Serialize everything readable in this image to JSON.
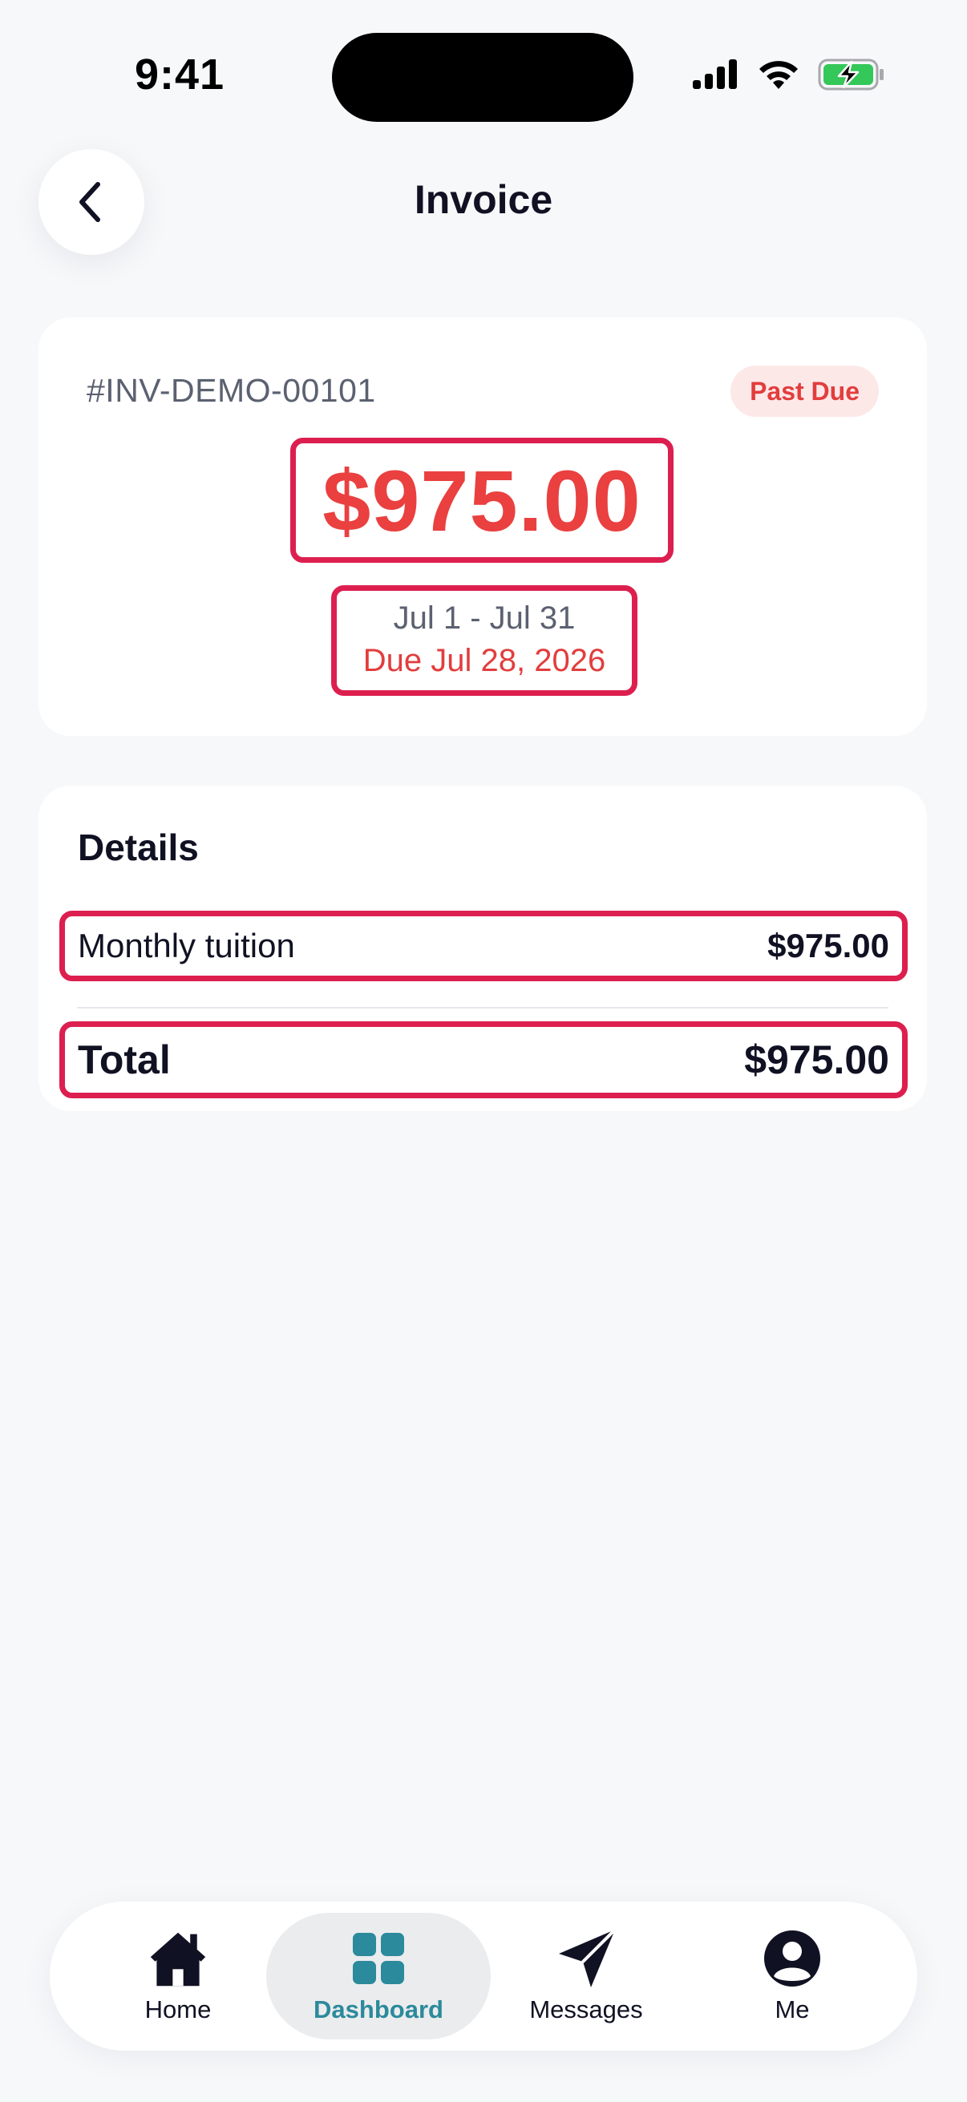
{
  "status_bar": {
    "time": "9:41",
    "icons": [
      "cellular-signal-icon",
      "wifi-icon",
      "battery-charging-icon"
    ]
  },
  "header": {
    "title": "Invoice",
    "back_icon": "chevron-left-icon"
  },
  "invoice": {
    "number": "#INV-DEMO-00101",
    "status": "Past Due",
    "amount": "$975.00",
    "period": "Jul 1 - Jul 31",
    "due": "Due Jul 28, 2026"
  },
  "details": {
    "title": "Details",
    "items": [
      {
        "label": "Monthly tuition",
        "amount": "$975.00"
      }
    ],
    "total_label": "Total",
    "total_amount": "$975.00"
  },
  "nav": {
    "tabs": [
      {
        "label": "Home",
        "icon": "home-icon",
        "active": false
      },
      {
        "label": "Dashboard",
        "icon": "dashboard-grid-icon",
        "active": true
      },
      {
        "label": "Messages",
        "icon": "paper-plane-icon",
        "active": false
      },
      {
        "label": "Me",
        "icon": "profile-icon",
        "active": false
      }
    ]
  },
  "colors": {
    "background": "#f7f8fa",
    "card": "#ffffff",
    "past_due_red": "#e23d3d",
    "badge_bg": "#fde8e8",
    "highlight_border": "#dc1f4f",
    "accent_teal": "#2b8a9b",
    "text_primary": "#101223",
    "text_secondary": "#5b6170"
  }
}
